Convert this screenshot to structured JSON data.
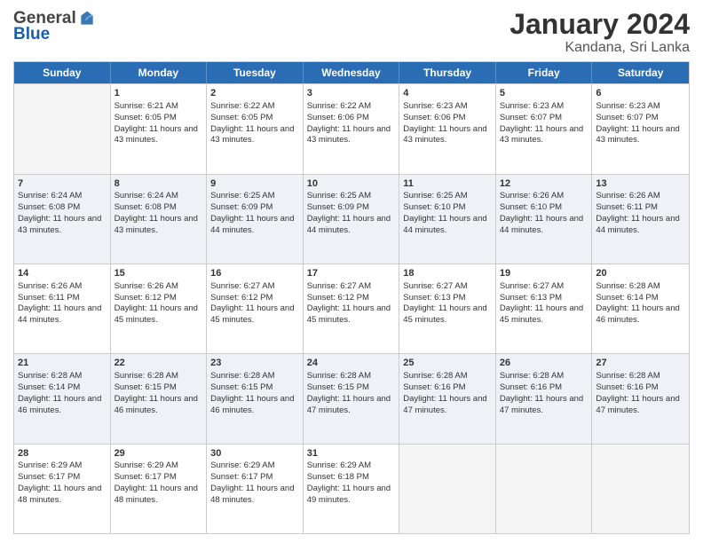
{
  "logo": {
    "general": "General",
    "blue": "Blue"
  },
  "header": {
    "month": "January 2024",
    "location": "Kandana, Sri Lanka"
  },
  "weekdays": [
    "Sunday",
    "Monday",
    "Tuesday",
    "Wednesday",
    "Thursday",
    "Friday",
    "Saturday"
  ],
  "weeks": [
    [
      {
        "day": "",
        "sunrise": "",
        "sunset": "",
        "daylight": "",
        "empty": true
      },
      {
        "day": "1",
        "sunrise": "Sunrise: 6:21 AM",
        "sunset": "Sunset: 6:05 PM",
        "daylight": "Daylight: 11 hours and 43 minutes."
      },
      {
        "day": "2",
        "sunrise": "Sunrise: 6:22 AM",
        "sunset": "Sunset: 6:05 PM",
        "daylight": "Daylight: 11 hours and 43 minutes."
      },
      {
        "day": "3",
        "sunrise": "Sunrise: 6:22 AM",
        "sunset": "Sunset: 6:06 PM",
        "daylight": "Daylight: 11 hours and 43 minutes."
      },
      {
        "day": "4",
        "sunrise": "Sunrise: 6:23 AM",
        "sunset": "Sunset: 6:06 PM",
        "daylight": "Daylight: 11 hours and 43 minutes."
      },
      {
        "day": "5",
        "sunrise": "Sunrise: 6:23 AM",
        "sunset": "Sunset: 6:07 PM",
        "daylight": "Daylight: 11 hours and 43 minutes."
      },
      {
        "day": "6",
        "sunrise": "Sunrise: 6:23 AM",
        "sunset": "Sunset: 6:07 PM",
        "daylight": "Daylight: 11 hours and 43 minutes."
      }
    ],
    [
      {
        "day": "7",
        "sunrise": "Sunrise: 6:24 AM",
        "sunset": "Sunset: 6:08 PM",
        "daylight": "Daylight: 11 hours and 43 minutes."
      },
      {
        "day": "8",
        "sunrise": "Sunrise: 6:24 AM",
        "sunset": "Sunset: 6:08 PM",
        "daylight": "Daylight: 11 hours and 43 minutes."
      },
      {
        "day": "9",
        "sunrise": "Sunrise: 6:25 AM",
        "sunset": "Sunset: 6:09 PM",
        "daylight": "Daylight: 11 hours and 44 minutes."
      },
      {
        "day": "10",
        "sunrise": "Sunrise: 6:25 AM",
        "sunset": "Sunset: 6:09 PM",
        "daylight": "Daylight: 11 hours and 44 minutes."
      },
      {
        "day": "11",
        "sunrise": "Sunrise: 6:25 AM",
        "sunset": "Sunset: 6:10 PM",
        "daylight": "Daylight: 11 hours and 44 minutes."
      },
      {
        "day": "12",
        "sunrise": "Sunrise: 6:26 AM",
        "sunset": "Sunset: 6:10 PM",
        "daylight": "Daylight: 11 hours and 44 minutes."
      },
      {
        "day": "13",
        "sunrise": "Sunrise: 6:26 AM",
        "sunset": "Sunset: 6:11 PM",
        "daylight": "Daylight: 11 hours and 44 minutes."
      }
    ],
    [
      {
        "day": "14",
        "sunrise": "Sunrise: 6:26 AM",
        "sunset": "Sunset: 6:11 PM",
        "daylight": "Daylight: 11 hours and 44 minutes."
      },
      {
        "day": "15",
        "sunrise": "Sunrise: 6:26 AM",
        "sunset": "Sunset: 6:12 PM",
        "daylight": "Daylight: 11 hours and 45 minutes."
      },
      {
        "day": "16",
        "sunrise": "Sunrise: 6:27 AM",
        "sunset": "Sunset: 6:12 PM",
        "daylight": "Daylight: 11 hours and 45 minutes."
      },
      {
        "day": "17",
        "sunrise": "Sunrise: 6:27 AM",
        "sunset": "Sunset: 6:12 PM",
        "daylight": "Daylight: 11 hours and 45 minutes."
      },
      {
        "day": "18",
        "sunrise": "Sunrise: 6:27 AM",
        "sunset": "Sunset: 6:13 PM",
        "daylight": "Daylight: 11 hours and 45 minutes."
      },
      {
        "day": "19",
        "sunrise": "Sunrise: 6:27 AM",
        "sunset": "Sunset: 6:13 PM",
        "daylight": "Daylight: 11 hours and 45 minutes."
      },
      {
        "day": "20",
        "sunrise": "Sunrise: 6:28 AM",
        "sunset": "Sunset: 6:14 PM",
        "daylight": "Daylight: 11 hours and 46 minutes."
      }
    ],
    [
      {
        "day": "21",
        "sunrise": "Sunrise: 6:28 AM",
        "sunset": "Sunset: 6:14 PM",
        "daylight": "Daylight: 11 hours and 46 minutes."
      },
      {
        "day": "22",
        "sunrise": "Sunrise: 6:28 AM",
        "sunset": "Sunset: 6:15 PM",
        "daylight": "Daylight: 11 hours and 46 minutes."
      },
      {
        "day": "23",
        "sunrise": "Sunrise: 6:28 AM",
        "sunset": "Sunset: 6:15 PM",
        "daylight": "Daylight: 11 hours and 46 minutes."
      },
      {
        "day": "24",
        "sunrise": "Sunrise: 6:28 AM",
        "sunset": "Sunset: 6:15 PM",
        "daylight": "Daylight: 11 hours and 47 minutes."
      },
      {
        "day": "25",
        "sunrise": "Sunrise: 6:28 AM",
        "sunset": "Sunset: 6:16 PM",
        "daylight": "Daylight: 11 hours and 47 minutes."
      },
      {
        "day": "26",
        "sunrise": "Sunrise: 6:28 AM",
        "sunset": "Sunset: 6:16 PM",
        "daylight": "Daylight: 11 hours and 47 minutes."
      },
      {
        "day": "27",
        "sunrise": "Sunrise: 6:28 AM",
        "sunset": "Sunset: 6:16 PM",
        "daylight": "Daylight: 11 hours and 47 minutes."
      }
    ],
    [
      {
        "day": "28",
        "sunrise": "Sunrise: 6:29 AM",
        "sunset": "Sunset: 6:17 PM",
        "daylight": "Daylight: 11 hours and 48 minutes."
      },
      {
        "day": "29",
        "sunrise": "Sunrise: 6:29 AM",
        "sunset": "Sunset: 6:17 PM",
        "daylight": "Daylight: 11 hours and 48 minutes."
      },
      {
        "day": "30",
        "sunrise": "Sunrise: 6:29 AM",
        "sunset": "Sunset: 6:17 PM",
        "daylight": "Daylight: 11 hours and 48 minutes."
      },
      {
        "day": "31",
        "sunrise": "Sunrise: 6:29 AM",
        "sunset": "Sunset: 6:18 PM",
        "daylight": "Daylight: 11 hours and 49 minutes."
      },
      {
        "day": "",
        "sunrise": "",
        "sunset": "",
        "daylight": "",
        "empty": true
      },
      {
        "day": "",
        "sunrise": "",
        "sunset": "",
        "daylight": "",
        "empty": true
      },
      {
        "day": "",
        "sunrise": "",
        "sunset": "",
        "daylight": "",
        "empty": true
      }
    ]
  ]
}
